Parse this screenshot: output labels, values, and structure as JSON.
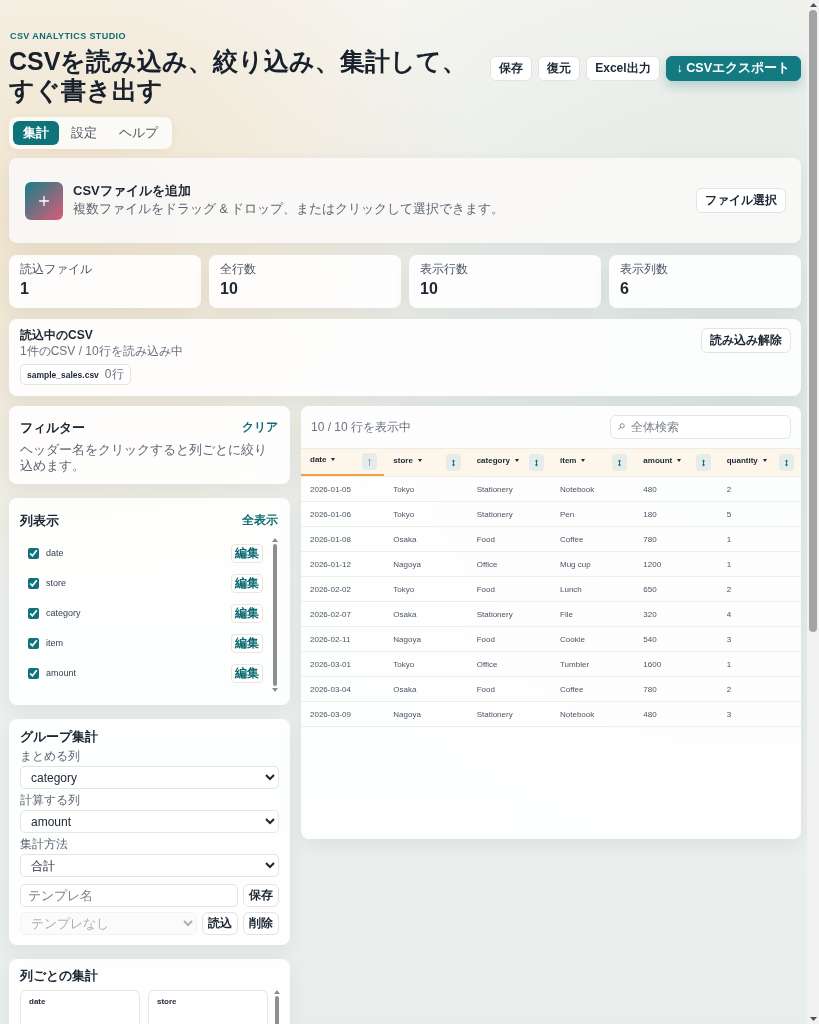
{
  "header": {
    "eyebrow": "CSV ANALYTICS STUDIO",
    "title": "CSVを読み込み、絞り込み、集計して、すぐ書き出す",
    "actions": [
      {
        "label": "保存",
        "kind": "plain"
      },
      {
        "label": "復元",
        "kind": "plain"
      },
      {
        "label": "Excel出力",
        "kind": "plain"
      },
      {
        "label": "↓ CSVエクスポート",
        "kind": "primary"
      }
    ]
  },
  "tabs": [
    {
      "label": "集計",
      "selected": true
    },
    {
      "label": "設定",
      "selected": false
    },
    {
      "label": "ヘルプ",
      "selected": false
    }
  ],
  "upload": {
    "title": "CSVファイルを追加",
    "hint": "複数ファイルをドラッグ & ドロップ、またはクリックして選択できます。",
    "button": "ファイル選択"
  },
  "stats": [
    {
      "label": "読込ファイル",
      "value": "1"
    },
    {
      "label": "全行数",
      "value": "10"
    },
    {
      "label": "表示行数",
      "value": "10"
    },
    {
      "label": "表示列数",
      "value": "6"
    }
  ],
  "loaded": {
    "title": "読込中のCSV",
    "summary": "1件のCSV / 10行を読み込み中",
    "button": "読み込み解除",
    "files": [
      {
        "name": "sample_sales.csv",
        "rows": "0行"
      }
    ]
  },
  "filter": {
    "title": "フィルター",
    "action": "クリア",
    "hint": "ヘッダー名をクリックすると列ごとに絞り込めます。"
  },
  "columns_panel": {
    "title": "列表示",
    "action": "全表示",
    "items": [
      {
        "label": "date",
        "checked": true,
        "button": "編集"
      },
      {
        "label": "store",
        "checked": true,
        "button": "編集"
      },
      {
        "label": "category",
        "checked": true,
        "button": "編集"
      },
      {
        "label": "item",
        "checked": true,
        "button": "編集"
      },
      {
        "label": "amount",
        "checked": true,
        "button": "編集"
      }
    ]
  },
  "group": {
    "title": "グループ集計",
    "fields": [
      {
        "label": "まとめる列",
        "value": "category"
      },
      {
        "label": "計算する列",
        "value": "amount"
      },
      {
        "label": "集計方法",
        "value": "合計"
      }
    ],
    "template_input": {
      "placeholder": "テンプレ名"
    },
    "save_button": "保存",
    "template_select": {
      "value": "テンプレなし",
      "disabled": true
    },
    "load_button": "読込",
    "delete_button": "削除"
  },
  "column_summary": {
    "title": "列ごとの集計",
    "cards": [
      {
        "name": "date"
      },
      {
        "name": "store"
      }
    ]
  },
  "table": {
    "count": "10 / 10 行を表示中",
    "search": {
      "placeholder": "全体検索"
    },
    "columns": [
      {
        "label": "date",
        "sorted": true
      },
      {
        "label": "store",
        "sorted": false
      },
      {
        "label": "category",
        "sorted": false
      },
      {
        "label": "item",
        "sorted": false
      },
      {
        "label": "amount",
        "sorted": false
      },
      {
        "label": "quantity",
        "sorted": false
      }
    ],
    "rows": [
      [
        "2026-01-05",
        "Tokyo",
        "Stationery",
        "Notebook",
        "480",
        "2"
      ],
      [
        "2026-01-06",
        "Tokyo",
        "Stationery",
        "Pen",
        "180",
        "5"
      ],
      [
        "2026-01-08",
        "Osaka",
        "Food",
        "Coffee",
        "780",
        "1"
      ],
      [
        "2026-01-12",
        "Nagoya",
        "Office",
        "Mug cup",
        "1200",
        "1"
      ],
      [
        "2026-02-02",
        "Tokyo",
        "Food",
        "Lunch",
        "650",
        "2"
      ],
      [
        "2026-02-07",
        "Osaka",
        "Stationery",
        "File",
        "320",
        "4"
      ],
      [
        "2026-02-11",
        "Nagoya",
        "Food",
        "Cookie",
        "540",
        "3"
      ],
      [
        "2026-03-01",
        "Tokyo",
        "Office",
        "Tumbler",
        "1600",
        "1"
      ],
      [
        "2026-03-04",
        "Osaka",
        "Food",
        "Coffee",
        "780",
        "2"
      ],
      [
        "2026-03-09",
        "Nagoya",
        "Stationery",
        "Notebook",
        "480",
        "3"
      ]
    ]
  }
}
